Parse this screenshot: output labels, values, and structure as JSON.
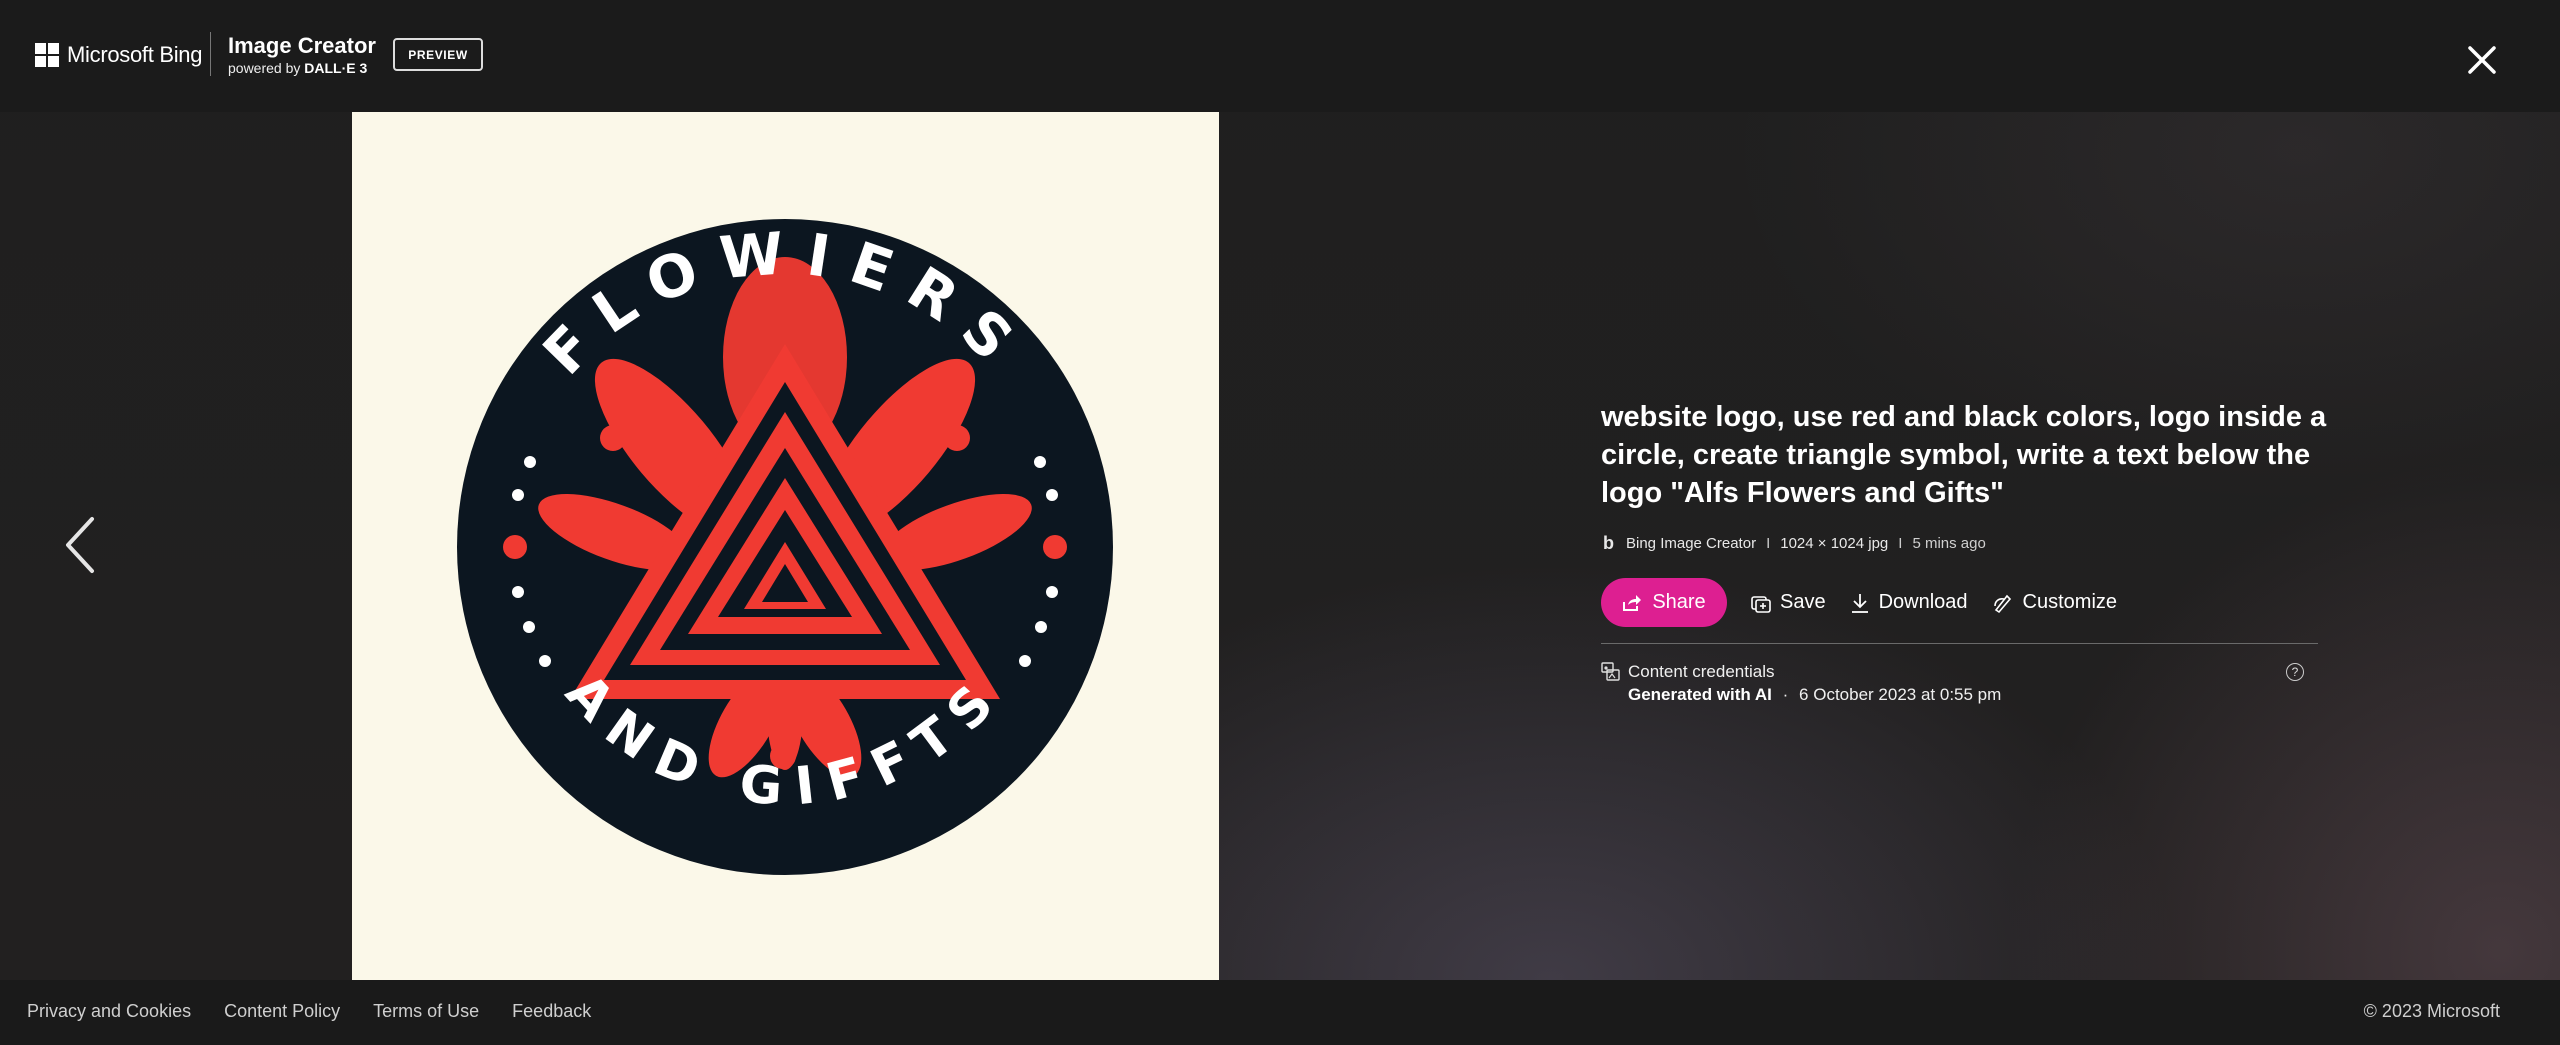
{
  "header": {
    "brand": "Microsoft Bing",
    "product_title": "Image Creator",
    "powered_by_prefix": "powered by",
    "powered_by_model": "DALL·E 3",
    "preview_label": "PREVIEW"
  },
  "icons": {
    "close": "close-icon",
    "prev": "chevron-left-icon",
    "share": "share-icon",
    "save": "save-icon",
    "download": "download-icon",
    "customize": "customize-icon",
    "credentials": "content-credentials-icon",
    "help": "help-icon"
  },
  "image": {
    "top_text": "FLOWIERS",
    "bottom_text": "AND GIFFTS",
    "colors": {
      "background": "#fbf8e9",
      "circle": "#0c1620",
      "accent": "#f03a32"
    }
  },
  "details": {
    "prompt": "website logo, use red and black colors, logo inside a circle, create triangle symbol, write a text below the logo \"Alfs Flowers and Gifts\"",
    "source": "Bing Image Creator",
    "dimensions": "1024 × 1024 jpg",
    "time_ago": "5 mins ago",
    "separator": "I"
  },
  "actions": {
    "share": "Share",
    "save": "Save",
    "download": "Download",
    "customize": "Customize"
  },
  "credentials": {
    "label": "Content credentials",
    "generated": "Generated with AI",
    "dot": "·",
    "date": "6 October 2023 at 0:55 pm",
    "help_glyph": "?"
  },
  "footer": {
    "links": [
      "Privacy and Cookies",
      "Content Policy",
      "Terms of Use",
      "Feedback"
    ],
    "copyright": "© 2023 Microsoft"
  },
  "colors": {
    "share_accent": "#dd1f91"
  }
}
